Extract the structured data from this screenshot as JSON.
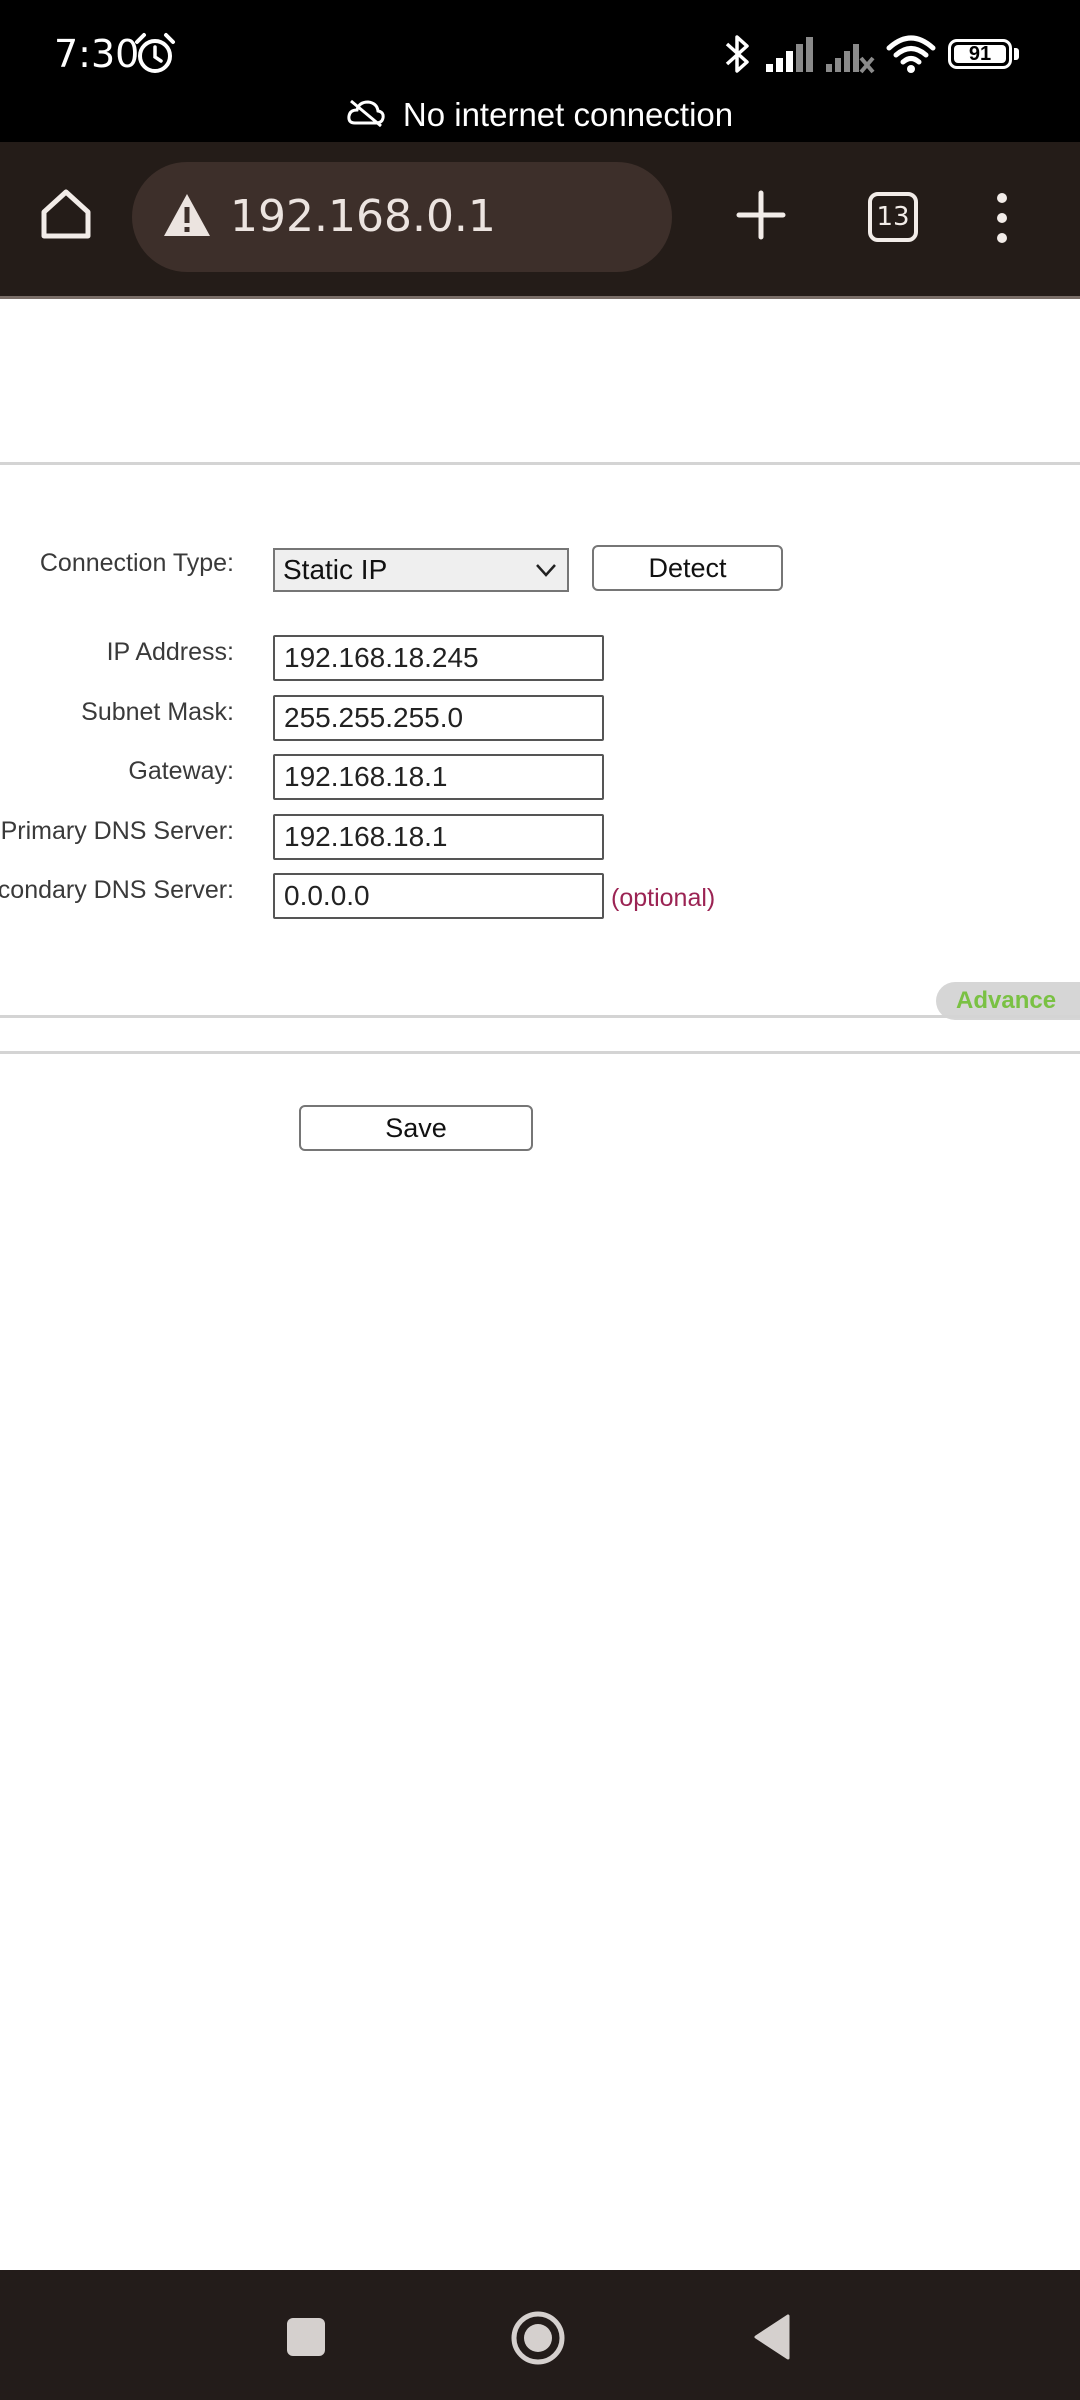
{
  "status_bar": {
    "time": "7:30",
    "battery": "91",
    "network_message": "No internet connection",
    "icons": [
      "alarm-icon",
      "bluetooth-icon",
      "signal-icon",
      "signal-no-service-icon",
      "wifi-icon",
      "battery-icon",
      "cloud-off-icon"
    ]
  },
  "browser": {
    "url": "192.168.0.1",
    "tab_count": "13",
    "icons": [
      "home-icon",
      "warning-icon",
      "new-tab-icon",
      "tabs-icon",
      "more-menu-icon"
    ]
  },
  "form": {
    "connection_type_label": "Connection Type:",
    "connection_type_value": "Static IP",
    "detect_label": "Detect",
    "ip_label": "IP Address:",
    "ip_value": "192.168.18.245",
    "subnet_label": "Subnet Mask:",
    "subnet_value": "255.255.255.0",
    "gateway_label": "Gateway:",
    "gateway_value": "192.168.18.1",
    "primary_dns_label": "Primary DNS Server:",
    "primary_dns_value": "192.168.18.1",
    "secondary_dns_label": "Secondary DNS Server:",
    "secondary_dns_value": "0.0.0.0",
    "optional_note": "(optional)",
    "advance_label": "Advance",
    "save_label": "Save"
  },
  "colors": {
    "optional_text": "#9b2353",
    "advance_text": "#7ac143",
    "toolbar_bg": "#241c18"
  }
}
